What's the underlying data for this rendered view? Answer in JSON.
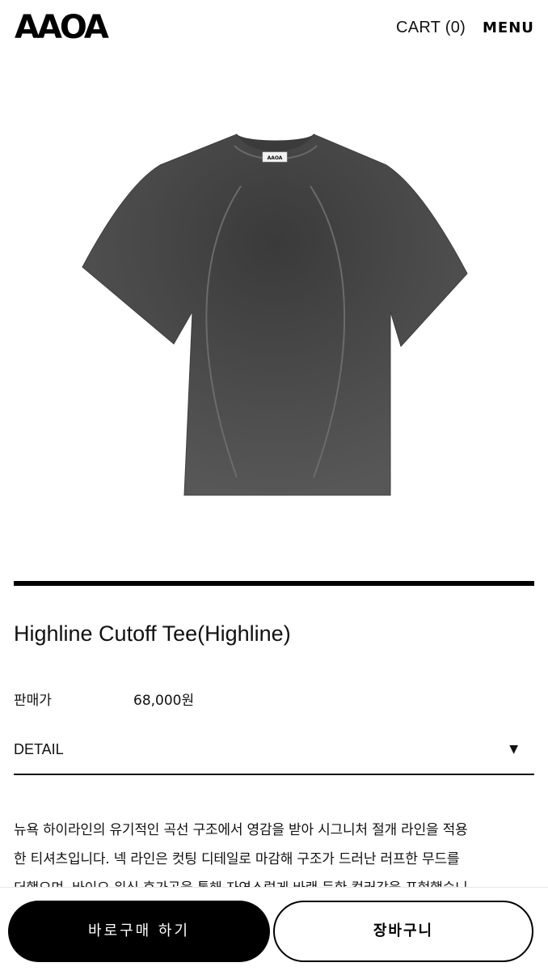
{
  "header": {
    "logo_text": "AAOA",
    "cart_label": "CART (0)",
    "menu_label": "MENU"
  },
  "product": {
    "name": "Highline Cutoff Tee(Highline)",
    "image_label": "AAOA",
    "price_label": "판매가",
    "price_value": "68,000원",
    "detail_label": "DETAIL",
    "detail_caret": "▼",
    "description_lines": [
      "뉴욕 하이라인의 유기적인 곡선 구조에서 영감을 받아 시그니처 절개 라인을 적용",
      "한 티셔츠입니다. 넥 라인은 컷팅 디테일로 마감해 구조가 드러난 러프한 무드를",
      "더했으며. 바이오 워싱 후가공을 통해 자연스럽게 바랜 듯한 컬러감을 표현했습니"
    ]
  },
  "actions": {
    "buy_now_label": "바로구매 하기",
    "add_to_cart_label": "장바구니"
  },
  "colors": {
    "primary": "#000000",
    "background": "#ffffff",
    "shirt": "#4a4a4a"
  }
}
